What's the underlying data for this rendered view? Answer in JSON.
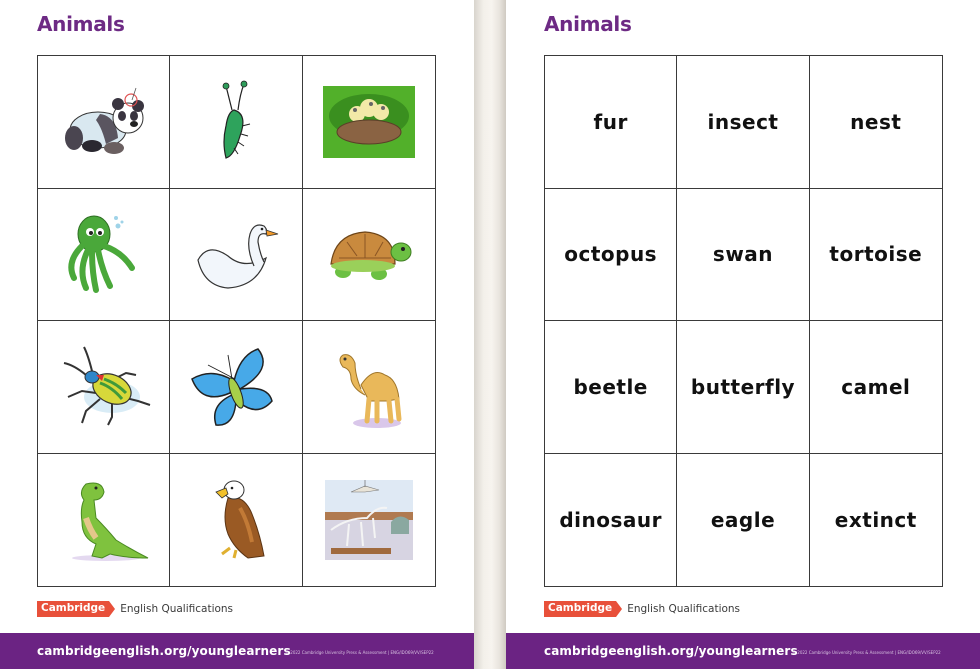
{
  "theme": {
    "title_color": "#6d2a84",
    "footer_color": "#6b2383",
    "logo_badge_color": "#e8503a"
  },
  "left_page": {
    "title": "Animals",
    "cards": [
      {
        "animal": "panda",
        "icon": "panda-icon"
      },
      {
        "animal": "insect",
        "icon": "insect-icon"
      },
      {
        "animal": "nest",
        "icon": "nest-icon"
      },
      {
        "animal": "octopus",
        "icon": "octopus-icon"
      },
      {
        "animal": "swan",
        "icon": "swan-icon"
      },
      {
        "animal": "tortoise",
        "icon": "tortoise-icon"
      },
      {
        "animal": "beetle",
        "icon": "beetle-icon"
      },
      {
        "animal": "butterfly",
        "icon": "butterfly-icon"
      },
      {
        "animal": "camel",
        "icon": "camel-icon"
      },
      {
        "animal": "dinosaur",
        "icon": "dinosaur-icon"
      },
      {
        "animal": "eagle",
        "icon": "eagle-icon"
      },
      {
        "animal": "extinct (museum skeletons)",
        "icon": "museum-skeleton-icon"
      }
    ]
  },
  "right_page": {
    "title": "Animals",
    "words": [
      "fur",
      "insect",
      "nest",
      "octopus",
      "swan",
      "tortoise",
      "beetle",
      "butterfly",
      "camel",
      "dinosaur",
      "eagle",
      "extinct"
    ]
  },
  "branding": {
    "badge": "Cambridge",
    "text": "English Qualifications"
  },
  "footer": {
    "url": "cambridgeenglish.org/younglearners",
    "copyright": "© 2022 Cambridge University Press & Assessment | ENG/IDO69/VV/SEP22"
  }
}
